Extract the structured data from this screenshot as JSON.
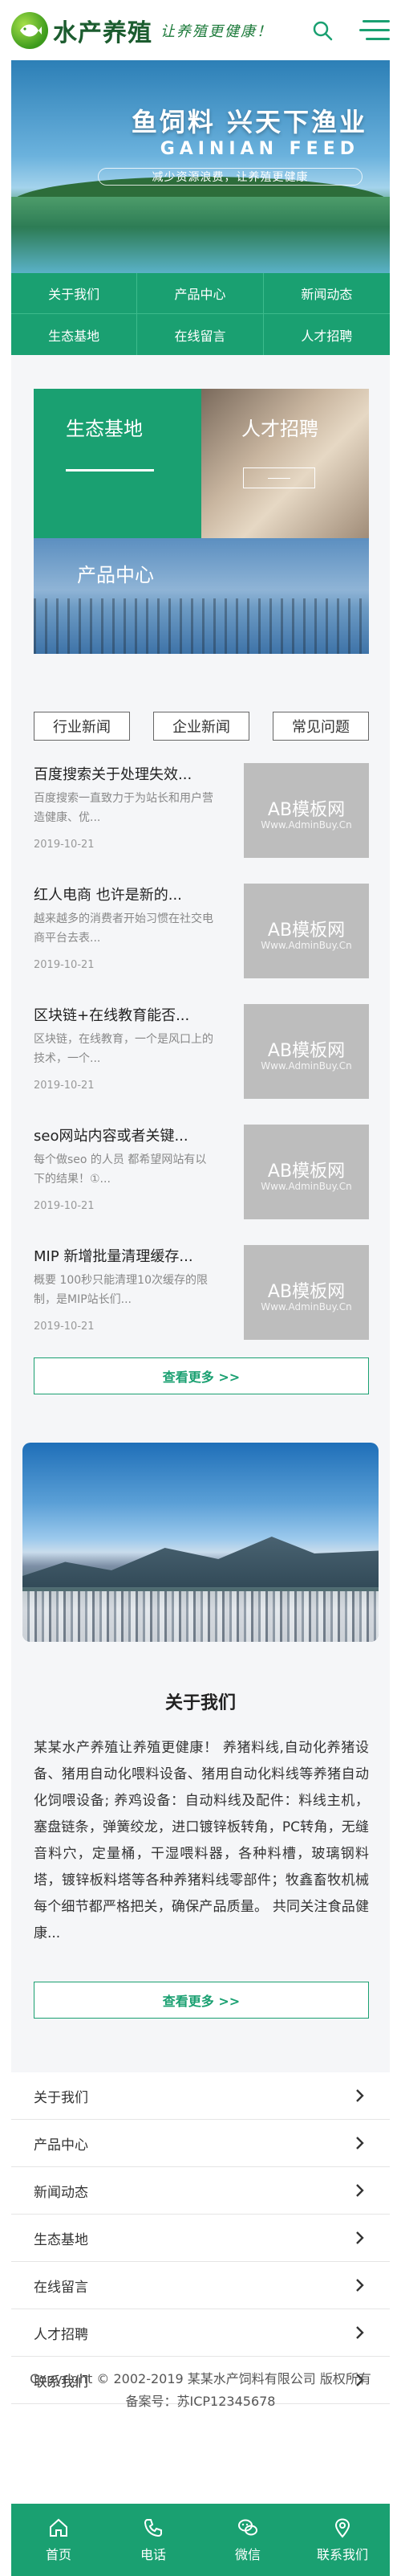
{
  "header": {
    "brand": "水产养殖",
    "slogan": "让养殖更健康！",
    "icons": [
      "fish-logo-icon",
      "search-icon",
      "menu-icon"
    ],
    "accent_color": "#1aa071"
  },
  "banner": {
    "title": "鱼饲料 兴天下渔业",
    "english": "GAINIAN FEED",
    "subtitle": "减少资源浪费，让养殖更健康"
  },
  "nav": {
    "items": [
      {
        "label": "关于我们"
      },
      {
        "label": "产品中心"
      },
      {
        "label": "新闻动态"
      },
      {
        "label": "生态基地"
      },
      {
        "label": "在线留言"
      },
      {
        "label": "人才招聘"
      }
    ]
  },
  "tiles": {
    "base": "生态基地",
    "talent": "人才招聘",
    "product": "产品中心"
  },
  "tabs": [
    "行业新闻",
    "企业新闻",
    "常见问题"
  ],
  "news": [
    {
      "title": "百度搜索关于处理失效...",
      "desc": "百度搜索一直致力于为站长和用户营造健康、优...",
      "date": "2019-10-21",
      "wm1": "AB模板网",
      "wm2": "Www.AdminBuy.Cn"
    },
    {
      "title": "红人电商 也许是新的...",
      "desc": "越来越多的消费者开始习惯在社交电商平台去表...",
      "date": "2019-10-21",
      "wm1": "AB模板网",
      "wm2": "Www.AdminBuy.Cn"
    },
    {
      "title": "区块链+在线教育能否...",
      "desc": "区块链，在线教育，一个是风口上的技术，一个...",
      "date": "2019-10-21",
      "wm1": "AB模板网",
      "wm2": "Www.AdminBuy.Cn"
    },
    {
      "title": "seo网站内容或者关键...",
      "desc": "每个做seo 的人员 都希望网站有以下的结果！①...",
      "date": "2019-10-21",
      "wm1": "AB模板网",
      "wm2": "Www.AdminBuy.Cn"
    },
    {
      "title": "MIP 新增批量清理缓存...",
      "desc": "概要 100秒只能清理10次缓存的限制，是MIP站长们...",
      "date": "2019-10-21",
      "wm1": "AB模板网",
      "wm2": "Www.AdminBuy.Cn"
    }
  ],
  "more_label": "查看更多 >>",
  "about": {
    "title": "关于我们",
    "text": "某某水产养殖让养殖更健康！ 养猪料线,自动化养猪设备、猪用自动化喂料设备、猪用自动化料线等养猪自动化饲喂设备; 养鸡设备：自动料线及配件：料线主机，塞盘链条，弹簧绞龙，进口镀锌板转角，PC转角，无缝音料穴，定量桶，干湿喂料器，各种料槽，玻璃钢料塔，镀锌板料塔等各种养猪料线零部件；牧鑫畜牧机械每个细节都严格把关，确保产品质量。 共同关注食品健康..."
  },
  "links": [
    "关于我们",
    "产品中心",
    "新闻动态",
    "生态基地",
    "在线留言",
    "人才招聘",
    "联系我们"
  ],
  "footer": {
    "copyright": "Copyright © 2002-2019 某某水产饲料有限公司 版权所有",
    "icp": "备案号：苏ICP12345678"
  },
  "bottom_bar": [
    {
      "label": "首页",
      "icon": "home-icon"
    },
    {
      "label": "电话",
      "icon": "phone-icon"
    },
    {
      "label": "微信",
      "icon": "wechat-icon"
    },
    {
      "label": "联系我们",
      "icon": "location-icon"
    }
  ]
}
